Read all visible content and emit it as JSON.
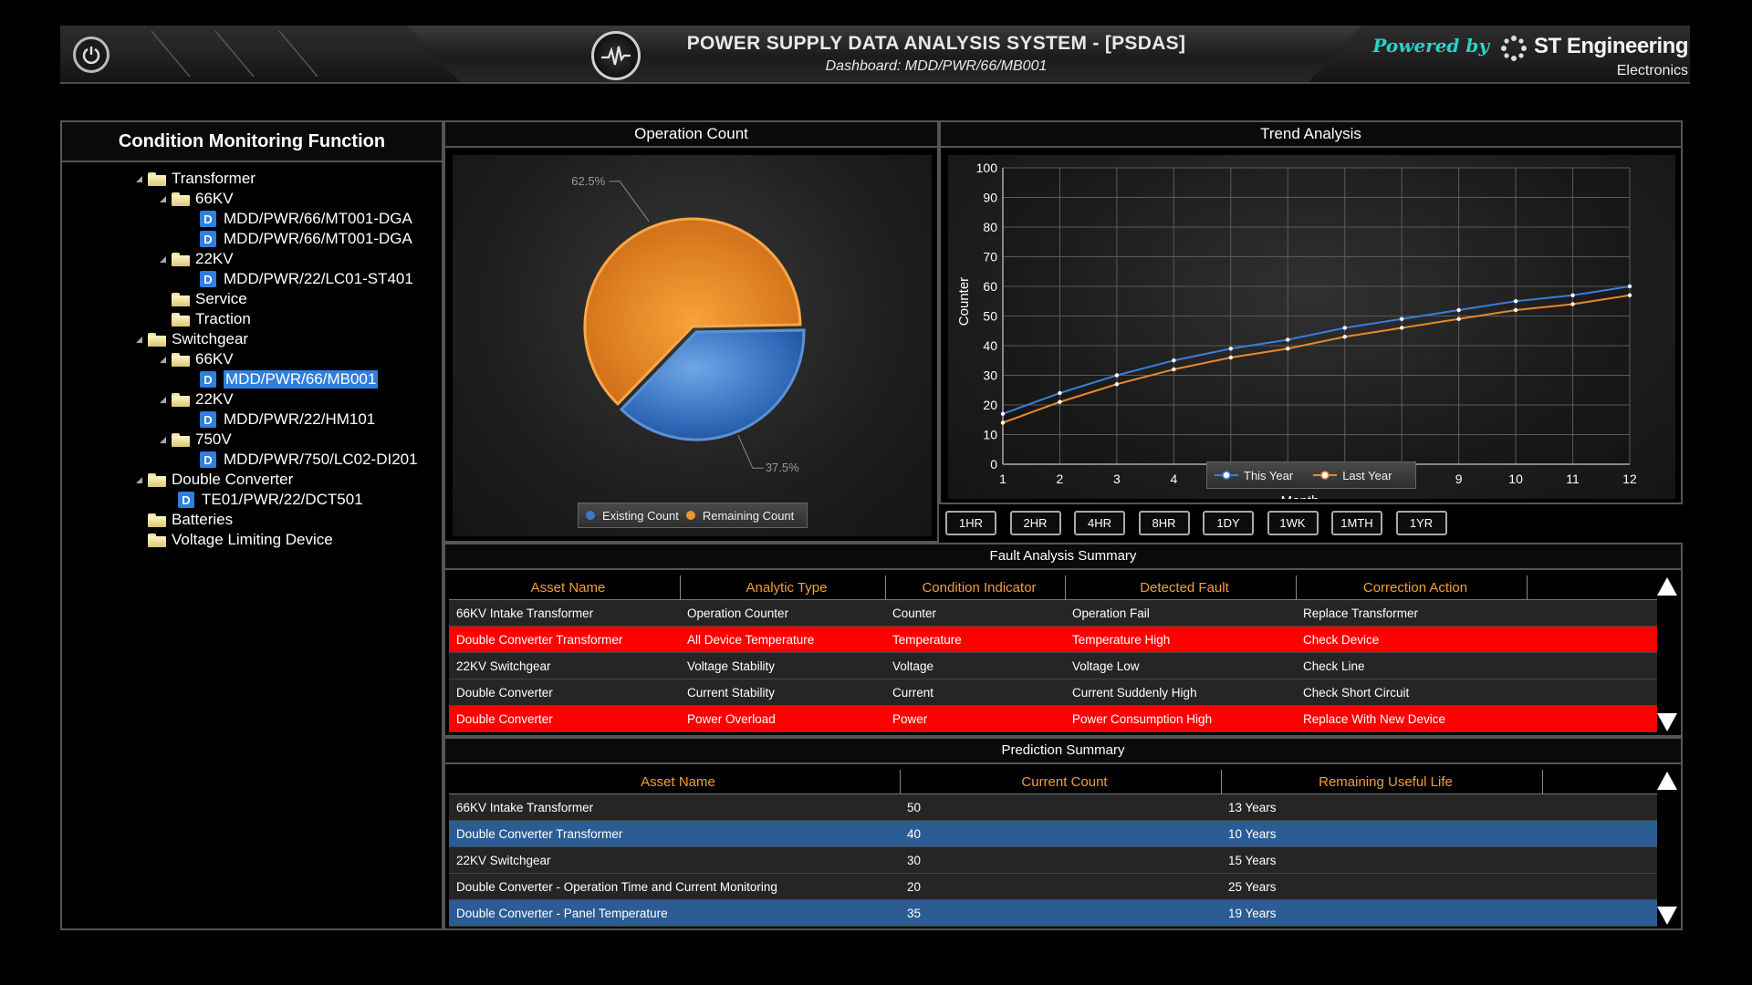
{
  "header": {
    "title": "POWER SUPPLY DATA ANALYSIS SYSTEM - [PSDAS]",
    "subtitle": "Dashboard: MDD/PWR/66/MB001",
    "powered_by": "Powered by",
    "brand_name": "ST Engineering",
    "brand_sub": "Electronics"
  },
  "tree": {
    "title": "Condition Monitoring Function",
    "nodes": [
      {
        "label": "Transformer",
        "kind": "folder",
        "expand": true
      },
      {
        "label": "66KV",
        "kind": "folder",
        "expand": true
      },
      {
        "label": "MDD/PWR/66/MT001-DGA",
        "kind": "doc"
      },
      {
        "label": "MDD/PWR/66/MT001-DGA",
        "kind": "doc"
      },
      {
        "label": "22KV",
        "kind": "folder",
        "expand": true
      },
      {
        "label": "MDD/PWR/22/LC01-ST401",
        "kind": "doc"
      },
      {
        "label": "Service",
        "kind": "folder"
      },
      {
        "label": "Traction",
        "kind": "folder"
      },
      {
        "label": "Switchgear",
        "kind": "folder",
        "expand": true
      },
      {
        "label": "66KV",
        "kind": "folder",
        "expand": true
      },
      {
        "label": "MDD/PWR/66/MB001",
        "kind": "doc",
        "selected": true
      },
      {
        "label": "22KV",
        "kind": "folder",
        "expand": true
      },
      {
        "label": "MDD/PWR/22/HM101",
        "kind": "doc"
      },
      {
        "label": "750V",
        "kind": "folder",
        "expand": true
      },
      {
        "label": "MDD/PWR/750/LC02-DI201",
        "kind": "doc"
      },
      {
        "label": "Double Converter",
        "kind": "folder",
        "expand": true
      },
      {
        "label": "TE01/PWR/22/DCT501",
        "kind": "doc"
      },
      {
        "label": "Batteries",
        "kind": "folder"
      },
      {
        "label": "Voltage Limiting Device",
        "kind": "folder"
      }
    ],
    "doc_icon_letter": "D"
  },
  "operation_count": {
    "title": "Operation Count",
    "chart_data": {
      "type": "pie",
      "slices": [
        {
          "name": "Existing Count",
          "value": 37.5,
          "label": "37.5%",
          "color": "#3a78c9"
        },
        {
          "name": "Remaining Count",
          "value": 62.5,
          "label": "62.5%",
          "color": "#f0952f"
        }
      ]
    }
  },
  "trend": {
    "title": "Trend Analysis",
    "chart_data": {
      "type": "line",
      "x": [
        1,
        2,
        3,
        4,
        5,
        6,
        7,
        8,
        9,
        10,
        11,
        12
      ],
      "xlabel": "Month",
      "ylabel": "Counter",
      "ylim": [
        0,
        100
      ],
      "yticks": [
        0,
        10,
        20,
        30,
        40,
        50,
        60,
        70,
        80,
        90,
        100
      ],
      "grid": true,
      "legend": "bottom",
      "series": [
        {
          "name": "This Year",
          "color": "#3b7dd8",
          "values": [
            17,
            24,
            30,
            35,
            39,
            42,
            46,
            49,
            52,
            55,
            57,
            60
          ]
        },
        {
          "name": "Last Year",
          "color": "#e8882a",
          "values": [
            14,
            21,
            27,
            32,
            36,
            39,
            43,
            46,
            49,
            52,
            54,
            57
          ]
        }
      ]
    }
  },
  "time_buttons": [
    "1HR",
    "2HR",
    "4HR",
    "8HR",
    "1DY",
    "1WK",
    "1MTH",
    "1YR"
  ],
  "fault": {
    "title": "Fault Analysis Summary",
    "columns": [
      "Asset Name",
      "Analytic Type",
      "Condition Indicator",
      "Detected Fault",
      "Correction Action",
      ""
    ],
    "rows": [
      {
        "cells": [
          "66KV Intake Transformer",
          "Operation Counter",
          "Counter",
          "Operation Fail",
          "Replace Transformer",
          ""
        ],
        "style": "normal"
      },
      {
        "cells": [
          "Double Converter Transformer",
          "All Device Temperature",
          "Temperature",
          "Temperature High",
          "Check Device",
          ""
        ],
        "style": "red"
      },
      {
        "cells": [
          "22KV Switchgear",
          "Voltage Stability",
          "Voltage",
          "Voltage Low",
          "Check Line",
          ""
        ],
        "style": "normal"
      },
      {
        "cells": [
          "Double Converter",
          "Current Stability",
          "Current",
          "Current Suddenly High",
          "Check Short Circuit",
          ""
        ],
        "style": "normal"
      },
      {
        "cells": [
          "Double Converter",
          "Power Overload",
          "Power",
          "Power Consumption High",
          "Replace With New Device",
          ""
        ],
        "style": "red"
      }
    ]
  },
  "prediction": {
    "title": "Prediction Summary",
    "columns": [
      "Asset Name",
      "Current Count",
      "Remaining Useful Life",
      ""
    ],
    "rows": [
      {
        "cells": [
          "66KV Intake Transformer",
          "50",
          "13 Years",
          ""
        ],
        "style": "normal"
      },
      {
        "cells": [
          "Double Converter Transformer",
          "40",
          "10 Years",
          ""
        ],
        "style": "blue"
      },
      {
        "cells": [
          "22KV Switchgear",
          "30",
          "15 Years",
          ""
        ],
        "style": "normal"
      },
      {
        "cells": [
          "Double Converter - Operation Time and Current Monitoring",
          "20",
          "25 Years",
          ""
        ],
        "style": "normal"
      },
      {
        "cells": [
          "Double Converter - Panel Temperature",
          "35",
          "19 Years",
          ""
        ],
        "style": "blue"
      }
    ]
  }
}
